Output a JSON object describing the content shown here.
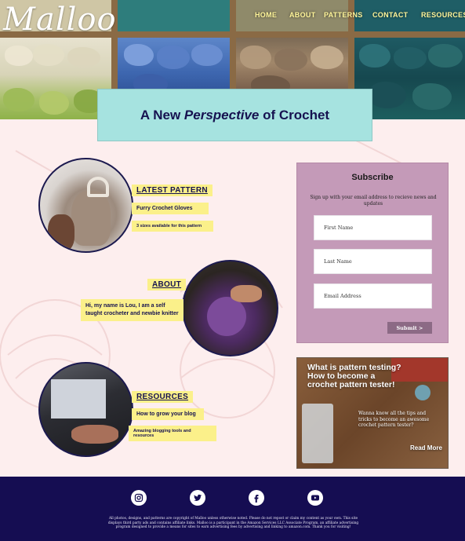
{
  "site": {
    "logo": "Malloo"
  },
  "nav": {
    "home": "HOME",
    "about": "ABOUT",
    "patterns": "PATTERNS",
    "contact": "CONTACT",
    "resources": "RESOURCES"
  },
  "hero": {
    "title_pre": "A New ",
    "title_em": "Perspective",
    "title_post": " of Crochet"
  },
  "latest_pattern": {
    "heading": "LATEST PATTERN",
    "name": "Furry Crochet Gloves",
    "detail": "3 sizes available for this pattern"
  },
  "about": {
    "heading": "ABOUT",
    "text": "Hi, my name is Lou, I am a self taught crocheter and newbie knitter"
  },
  "resources": {
    "heading": "RESOURCES",
    "item1": "How to grow your blog",
    "item2": "Amazing blogging tools and resources"
  },
  "subscribe": {
    "title": "Subscribe",
    "description": "Sign up with your email address to recieve news and updates",
    "first_name_placeholder": "First Name",
    "last_name_placeholder": "Last Name",
    "email_placeholder": "Email Address",
    "submit_label": "Submit >"
  },
  "blog_card": {
    "headline": "What is pattern testing? How to become a crochet pattern tester!",
    "blurb": "Wanna know all the tips and tricks to become an awesome crochet pattern tester?",
    "read_more": "Read More"
  },
  "footer": {
    "social": [
      "instagram-icon",
      "twitter-icon",
      "facebook-icon",
      "youtube-icon"
    ],
    "legal": "All photos, designs, and patterns are copyright of Malloo unless otherwise noted. Please do not repost or claim my content as your own. This site displays third party ads and contains affiliate links. Malloo is a participant in the Amazon Services LLC Associate Program, an affiliate advertising program designed to provide a means for sites to earn advertising fees by advertising and linking to amazon.com. Thank you for visiting!"
  },
  "colors": {
    "navy": "#150d52",
    "mint": "#a6e3e0",
    "highlight": "#fbf08a",
    "mauve": "#c49ab8",
    "page": "#fdeeee"
  }
}
